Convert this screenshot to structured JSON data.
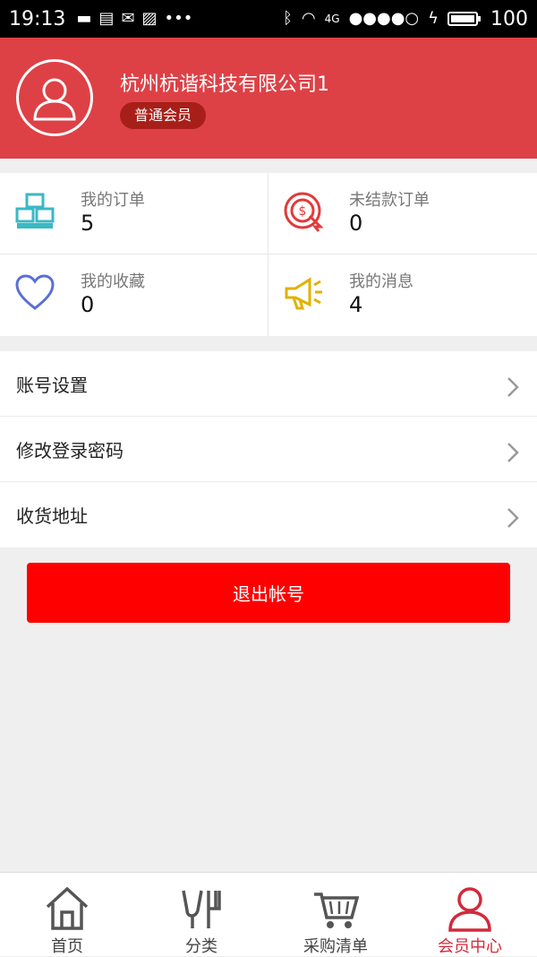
{
  "status_bar": {
    "time": "19:13",
    "network": "4G",
    "battery": "100"
  },
  "profile": {
    "company_name": "杭州杭谐科技有限公司1",
    "member_level": "普通会员"
  },
  "stats": [
    {
      "label": "我的订单",
      "value": "5",
      "icon": "boxes-icon",
      "color": "#3bb8c4"
    },
    {
      "label": "未结款订单",
      "value": "0",
      "icon": "target-dollar-icon",
      "color": "#e23a3a"
    },
    {
      "label": "我的收藏",
      "value": "0",
      "icon": "heart-icon",
      "color": "#5b6fd6"
    },
    {
      "label": "我的消息",
      "value": "4",
      "icon": "megaphone-icon",
      "color": "#e2b100"
    }
  ],
  "menu": [
    {
      "label": "账号设置"
    },
    {
      "label": "修改登录密码"
    },
    {
      "label": "收货地址"
    }
  ],
  "logout_label": "退出帐号",
  "tabs": [
    {
      "label": "首页",
      "icon": "home-icon",
      "active": false
    },
    {
      "label": "分类",
      "icon": "fork-knife-icon",
      "active": false
    },
    {
      "label": "采购清单",
      "icon": "cart-icon",
      "active": false
    },
    {
      "label": "会员中心",
      "icon": "user-icon",
      "active": true
    }
  ],
  "colors": {
    "header_bg": "#dd4146",
    "badge_bg": "#a81f19",
    "logout_bg": "#ff0000",
    "active_tab": "#d22a3c"
  }
}
